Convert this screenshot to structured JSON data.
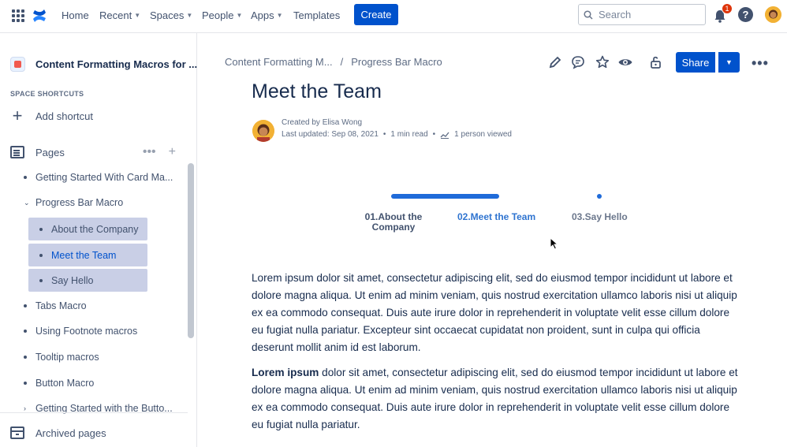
{
  "topnav": {
    "home": "Home",
    "recent": "Recent",
    "spaces": "Spaces",
    "people": "People",
    "apps": "Apps",
    "templates": "Templates",
    "create": "Create",
    "search_placeholder": "Search",
    "notification_count": "1",
    "help": "?"
  },
  "sidebar": {
    "space_title": "Content Formatting Macros for ...",
    "shortcuts_label": "SPACE SHORTCUTS",
    "add_shortcut": "Add shortcut",
    "pages_label": "Pages",
    "items": [
      {
        "label": "Getting Started With Card Ma..."
      },
      {
        "label": "Progress Bar Macro"
      },
      {
        "label": "About the Company"
      },
      {
        "label": "Meet the Team"
      },
      {
        "label": "Say Hello"
      },
      {
        "label": "Tabs Macro"
      },
      {
        "label": "Using Footnote macros"
      },
      {
        "label": "Tooltip macros"
      },
      {
        "label": "Button Macro"
      },
      {
        "label": "Getting Started with the Butto..."
      }
    ],
    "archived": "Archived pages"
  },
  "breadcrumb": {
    "parent": "Content Formatting M...",
    "separator": "/",
    "current": "Progress Bar Macro"
  },
  "toolbar": {
    "share": "Share"
  },
  "page": {
    "title": "Meet the Team",
    "created_by": "Created by Elisa Wong",
    "last_updated": "Last updated: Sep 08, 2021",
    "read_time": "1 min read",
    "viewed": "1 person viewed"
  },
  "progress": {
    "steps": [
      {
        "line1": "01.About the",
        "line2": "Company"
      },
      {
        "line1": "02.Meet the Team",
        "line2": ""
      },
      {
        "line1": "03.Say Hello",
        "line2": ""
      }
    ],
    "current_step": 2,
    "colors": {
      "active": "#1f6bd9",
      "text_active": "#2f74d0"
    }
  },
  "body": {
    "para1": "Lorem ipsum dolor sit amet, consectetur adipiscing elit, sed do eiusmod tempor incididunt ut labore et dolore magna aliqua. Ut enim ad minim veniam, quis nostrud exercitation ullamco laboris nisi ut aliquip ex ea commodo consequat. Duis aute irure dolor in reprehenderit in voluptate velit esse cillum dolore eu fugiat nulla pariatur. Excepteur sint occaecat cupidatat non proident, sunt in culpa qui officia deserunt mollit anim id est laborum.",
    "para2_bold": "Lorem ipsum",
    "para2_rest": " dolor sit amet, consectetur adipiscing elit, sed do eiusmod tempor incididunt ut labore et dolore magna aliqua. Ut enim ad minim veniam, quis nostrud exercitation ullamco laboris nisi ut aliquip ex ea commodo consequat. Duis aute irure dolor in reprehenderit in voluptate velit esse cillum dolore eu fugiat nulla pariatur."
  },
  "colors": {
    "brand": "#0052cc",
    "sidebar_selected": "#c9cfe6",
    "badge": "#de350b"
  }
}
